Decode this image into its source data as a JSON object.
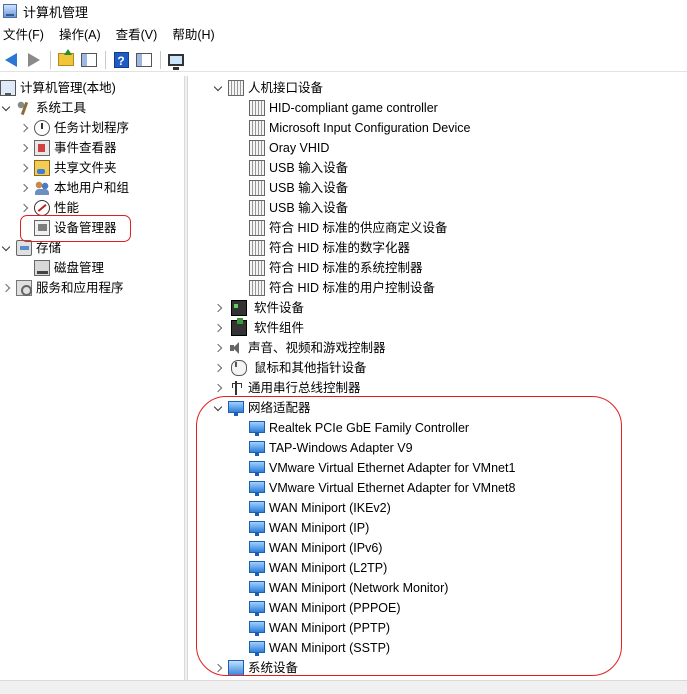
{
  "window": {
    "title": "计算机管理"
  },
  "menu": [
    "文件(F)",
    "操作(A)",
    "查看(V)",
    "帮助(H)"
  ],
  "toolbar": {
    "back_icon": "arrow-left-icon",
    "forward_icon": "arrow-right-icon",
    "up_icon": "folder-up-icon",
    "console_tree_icon": "show-hide-tree-icon",
    "help_icon": "help-icon",
    "help_glyph": "?",
    "properties_icon": "properties-icon",
    "monitor_icon": "monitor-icon"
  },
  "left_tree": {
    "root": "计算机管理(本地)",
    "system_tools": "系统工具",
    "task_scheduler": "任务计划程序",
    "event_viewer": "事件查看器",
    "shared_folders": "共享文件夹",
    "local_users": "本地用户和组",
    "performance": "性能",
    "device_manager": "设备管理器",
    "storage": "存储",
    "disk_management": "磁盘管理",
    "services_apps": "服务和应用程序"
  },
  "right_tree": {
    "hid_category": "人机接口设备",
    "hid_items": [
      "HID-compliant game controller",
      "Microsoft Input Configuration Device",
      "Oray VHID",
      "USB 输入设备",
      "USB 输入设备",
      "USB 输入设备",
      "符合 HID 标准的供应商定义设备",
      "符合 HID 标准的数字化器",
      "符合 HID 标准的系统控制器",
      "符合 HID 标准的用户控制设备"
    ],
    "software_devices": "软件设备",
    "software_components": "软件组件",
    "sound": "声音、视频和游戏控制器",
    "mice": "鼠标和其他指针设备",
    "usb_controllers": "通用串行总线控制器",
    "network_category": "网络适配器",
    "network_items": [
      "Realtek PCIe GbE Family Controller",
      "TAP-Windows Adapter V9",
      "VMware Virtual Ethernet Adapter for VMnet1",
      "VMware Virtual Ethernet Adapter for VMnet8",
      "WAN Miniport (IKEv2)",
      "WAN Miniport (IP)",
      "WAN Miniport (IPv6)",
      "WAN Miniport (L2TP)",
      "WAN Miniport (Network Monitor)",
      "WAN Miniport (PPPOE)",
      "WAN Miniport (PPTP)",
      "WAN Miniport (SSTP)"
    ],
    "system_devices": "系统设备"
  },
  "annotation_color": "#e02020"
}
